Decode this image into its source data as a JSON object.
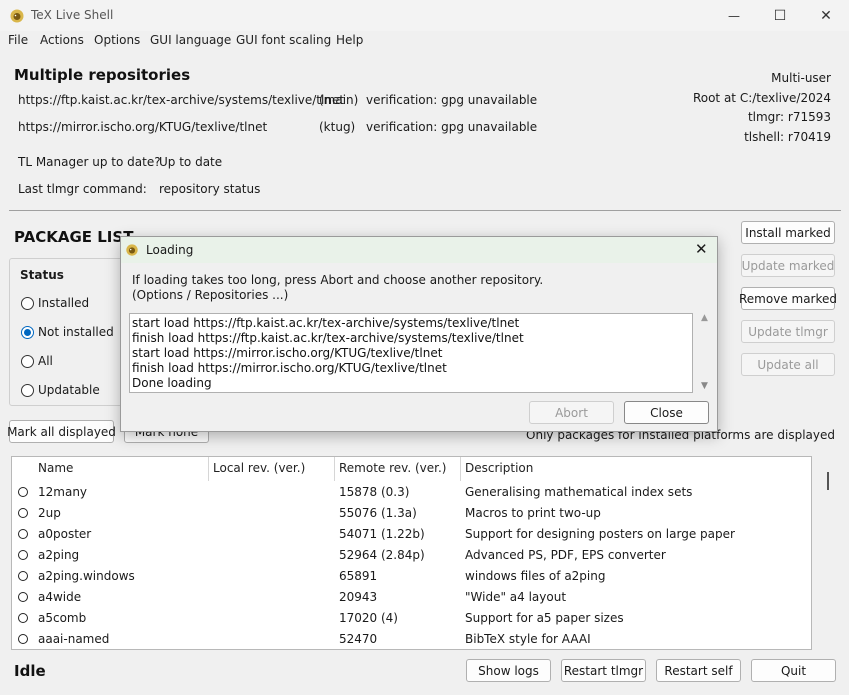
{
  "window": {
    "title": "TeX Live Shell",
    "controls": {
      "minimize": "—",
      "maximize": "☐",
      "close": "✕"
    }
  },
  "menu": [
    "File",
    "Actions",
    "Options",
    "GUI language",
    "GUI font scaling",
    "Help"
  ],
  "repos": {
    "heading": "Multiple repositories",
    "items": [
      {
        "url": "https://ftp.kaist.ac.kr/tex-archive/systems/texlive/tlnet",
        "tag": "(main)",
        "verification": "verification: gpg unavailable"
      },
      {
        "url": "https://mirror.ischo.org/KTUG/texlive/tlnet",
        "tag": "(ktug)",
        "verification": "verification: gpg unavailable"
      }
    ],
    "tlmgr_uptodate_label": "TL Manager up to date?",
    "tlmgr_uptodate_value": "Up to date",
    "last_cmd_label": "Last tlmgr command:",
    "last_cmd_value": "repository status"
  },
  "info": {
    "mode": "Multi-user",
    "root": "Root at C:/texlive/2024",
    "tlmgr": "tlmgr: r71593",
    "tlshell": "tlshell: r70419"
  },
  "package_list": {
    "heading": "PACKAGE LIST",
    "status_label": "Status",
    "status_options": [
      "Installed",
      "Not installed",
      "All",
      "Updatable"
    ],
    "status_selected": "Not installed",
    "mark_all": "Mark all displayed",
    "mark_none": "Mark none",
    "platform_note": "Only packages for installed platforms are displayed",
    "columns": [
      "Name",
      "Local rev. (ver.)",
      "Remote rev. (ver.)",
      "Description"
    ],
    "rows": [
      {
        "name": "12many",
        "local": "",
        "remote": "15878 (0.3)",
        "desc": "Generalising mathematical index sets"
      },
      {
        "name": "2up",
        "local": "",
        "remote": "55076 (1.3a)",
        "desc": "Macros to print two-up"
      },
      {
        "name": "a0poster",
        "local": "",
        "remote": "54071 (1.22b)",
        "desc": "Support for designing posters on large paper"
      },
      {
        "name": "a2ping",
        "local": "",
        "remote": "52964 (2.84p)",
        "desc": "Advanced PS, PDF, EPS converter"
      },
      {
        "name": "a2ping.windows",
        "local": "",
        "remote": "65891",
        "desc": "windows files of a2ping"
      },
      {
        "name": "a4wide",
        "local": "",
        "remote": "20943",
        "desc": "\"Wide\" a4 layout"
      },
      {
        "name": "a5comb",
        "local": "",
        "remote": "17020 (4)",
        "desc": "Support for a5 paper sizes"
      },
      {
        "name": "aaai-named",
        "local": "",
        "remote": "52470",
        "desc": "BibTeX style for AAAI"
      }
    ]
  },
  "actions": {
    "install_marked": "Install marked",
    "update_marked": "Update marked",
    "remove_marked": "Remove marked",
    "update_tlmgr": "Update tlmgr",
    "update_all": "Update all"
  },
  "footer": {
    "status": "Idle",
    "show_logs": "Show logs",
    "restart_tlmgr": "Restart tlmgr",
    "restart_self": "Restart self",
    "quit": "Quit"
  },
  "dialog": {
    "title": "Loading",
    "message1": "If loading takes too long, press Abort and choose another repository.",
    "message2": "(Options / Repositories ...)",
    "log": [
      "start load https://ftp.kaist.ac.kr/tex-archive/systems/texlive/tlnet",
      "finish load https://ftp.kaist.ac.kr/tex-archive/systems/texlive/tlnet",
      "start load https://mirror.ischo.org/KTUG/texlive/tlnet",
      "finish load https://mirror.ischo.org/KTUG/texlive/tlnet",
      "Done loading"
    ],
    "abort": "Abort",
    "close": "Close"
  },
  "icons": {
    "app": "tex-lion-icon",
    "scroll_up": "▲",
    "scroll_down": "▼"
  }
}
